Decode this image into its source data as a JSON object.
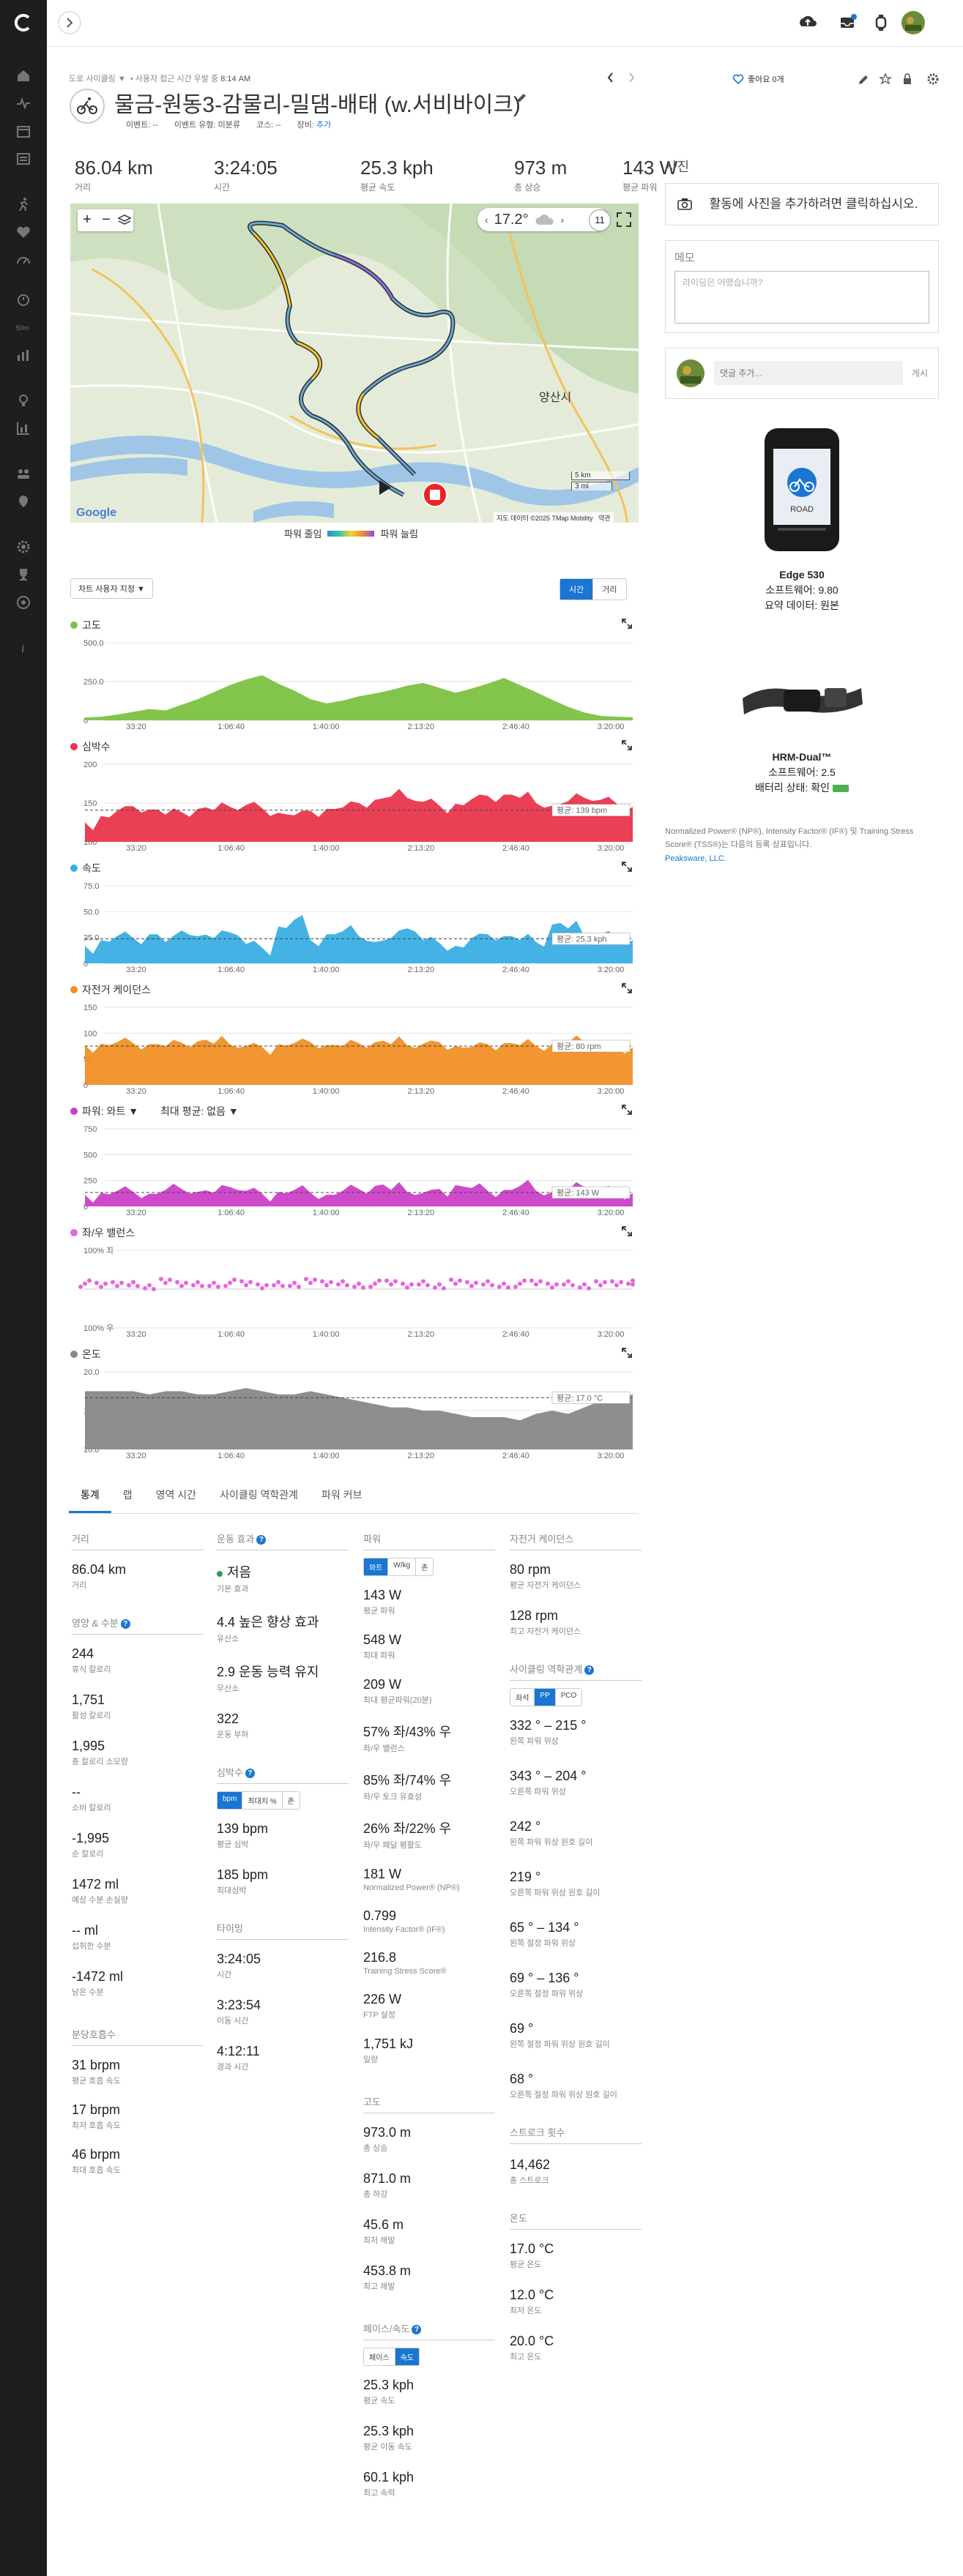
{
  "activity": {
    "breadcrumb": "도로 사이클링",
    "subtitle_privacy": "사용자 접근 시간 우발 중",
    "subtitle_time": "8:14 AM",
    "title": "물금-원동3-감물리-밀댐-배태 (w.서비바이크)",
    "event_label": "이벤트: --",
    "event_type_label": "이벤트 유형: 미분류",
    "course_label": "코스: --",
    "gear_label": "장비:",
    "gear_add": "추가",
    "likes": "좋아요 0개"
  },
  "stats": [
    {
      "value": "86.04 km",
      "label": "거리"
    },
    {
      "value": "3:24:05",
      "label": "시간"
    },
    {
      "value": "25.3 kph",
      "label": "평균 속도"
    },
    {
      "value": "973 m",
      "label": "총 상승"
    },
    {
      "value": "143 W",
      "label": "평균 파워"
    }
  ],
  "map": {
    "temperature": "17.2°",
    "weather_icon": "cloud-icon",
    "scale_km": "5 km",
    "scale_mi": "3 mi",
    "attribution": "지도 데이터 ©2025 TMap Mobility",
    "terms": "약관",
    "google": "Google",
    "city": "양산시",
    "legend_low": "파워 줄임",
    "legend_high": "파워 늘림",
    "counter": "11"
  },
  "chart_controls": {
    "custom": "차트 사용자 지정 ▼",
    "time": "시간",
    "distance": "거리"
  },
  "chart_data": [
    {
      "type": "area",
      "title": "고도",
      "color": "#7cc242",
      "ylabels": [
        "500.0",
        "250.0",
        "0"
      ],
      "ylim": [
        0,
        550
      ],
      "x": [
        "33:20",
        "1:06:40",
        "1:40:00",
        "2:13:20",
        "2:46:40",
        "3:20:00"
      ],
      "values": [
        20,
        25,
        40,
        60,
        80,
        70,
        110,
        150,
        200,
        250,
        290,
        320,
        260,
        210,
        150,
        120,
        140,
        170,
        190,
        215,
        245,
        265,
        230,
        195,
        225,
        260,
        300,
        250,
        200,
        145,
        95,
        55,
        32,
        25,
        22
      ]
    },
    {
      "type": "area",
      "title": "심박수",
      "color": "#e9364d",
      "ylabels": [
        "200",
        "150",
        "100"
      ],
      "ylim": [
        90,
        210
      ],
      "avg": 139,
      "avg_label": "평균: 139 bpm",
      "x": [
        "33:20",
        "1:06:40",
        "1:40:00",
        "2:13:20",
        "2:46:40",
        "3:20:00"
      ],
      "values": [
        120,
        130,
        138,
        145,
        140,
        132,
        136,
        141,
        139,
        144,
        147,
        142,
        135,
        131,
        138,
        141,
        143,
        150,
        155,
        160,
        158,
        152,
        146,
        149,
        156,
        161,
        163,
        158,
        150,
        146,
        153,
        158,
        155,
        149,
        144
      ]
    },
    {
      "type": "area",
      "title": "속도",
      "color": "#3aaee3",
      "ylabels": [
        "75.0",
        "50.0",
        "25.0",
        "0"
      ],
      "ylim": [
        0,
        80
      ],
      "avg": 25.3,
      "avg_label": "평균: 25.3 kph",
      "x": [
        "33:20",
        "1:06:40",
        "1:40:00",
        "2:13:20",
        "2:46:40",
        "3:20:00"
      ],
      "values": [
        18,
        24,
        28,
        26,
        30,
        22,
        34,
        28,
        26,
        32,
        20,
        16,
        38,
        45,
        24,
        30,
        33,
        28,
        22,
        26,
        36,
        24,
        21,
        18,
        26,
        30,
        28,
        24,
        22,
        40,
        36,
        28,
        30,
        27,
        24
      ]
    },
    {
      "type": "area",
      "title": "자전거 케이던스",
      "color": "#f09026",
      "ylabels": [
        "150",
        "100",
        "50",
        "0"
      ],
      "ylim": [
        0,
        160
      ],
      "avg": 80,
      "avg_label": "평균: 80 rpm",
      "x": [
        "33:20",
        "1:06:40",
        "1:40:00",
        "2:13:20",
        "2:46:40",
        "3:20:00"
      ],
      "values": [
        82,
        85,
        88,
        86,
        84,
        80,
        87,
        90,
        85,
        83,
        80,
        78,
        84,
        86,
        88,
        82,
        80,
        86,
        88,
        84,
        82,
        85,
        88,
        80,
        78,
        84,
        86,
        82,
        80,
        84,
        86,
        88,
        82,
        80,
        78
      ]
    },
    {
      "type": "area",
      "title": "파워: 와트 ▼",
      "extra": "최대 평균: 없음 ▼",
      "color": "#cc40c8",
      "ylabels": [
        "750",
        "500",
        "250",
        "0"
      ],
      "ylim": [
        0,
        800
      ],
      "avg": 143,
      "avg_label": "평균: 143 W",
      "x": [
        "33:20",
        "1:06:40",
        "1:40:00",
        "2:13:20",
        "2:46:40",
        "3:20:00"
      ],
      "values": [
        120,
        140,
        160,
        150,
        130,
        170,
        180,
        150,
        140,
        200,
        160,
        130,
        150,
        170,
        140,
        120,
        160,
        180,
        210,
        170,
        150,
        140,
        180,
        220,
        190,
        160,
        170,
        210,
        160,
        150,
        170,
        200,
        180,
        150,
        140
      ]
    },
    {
      "type": "scatter",
      "title": "좌/우 밸런스",
      "color": "#e567dc",
      "ylabels": [
        "100% 좌",
        "100% 우"
      ],
      "x": [
        "33:20",
        "1:06:40",
        "1:40:00",
        "2:13:20",
        "2:46:40",
        "3:20:00"
      ],
      "values": [
        57,
        55,
        58,
        56,
        54,
        59,
        57,
        55,
        56,
        58,
        57,
        55,
        56,
        57,
        59,
        58,
        56,
        55,
        57,
        58,
        56,
        57,
        55,
        58,
        57,
        56,
        55,
        57,
        58,
        56,
        57,
        55,
        56,
        58,
        57
      ]
    },
    {
      "type": "area",
      "title": "온도",
      "color": "#888888",
      "ylabels": [
        "20.0",
        "15.0",
        "10.0"
      ],
      "ylim": [
        9,
        21
      ],
      "avg": 17.0,
      "avg_label": "평균: 17.0 °C",
      "x": [
        "33:20",
        "1:06:40",
        "1:40:00",
        "2:13:20",
        "2:46:40",
        "3:20:00"
      ],
      "values": [
        18,
        18,
        18,
        18,
        17.5,
        18,
        18,
        17.5,
        17.5,
        18,
        18.5,
        18,
        17.5,
        17.5,
        18,
        17.5,
        17,
        16.5,
        16,
        15.5,
        15.5,
        15,
        15,
        14.5,
        14,
        14,
        14,
        13.5,
        14.5,
        15,
        14.5,
        15.5,
        16.5,
        17,
        17.5
      ]
    }
  ],
  "tabs": [
    "통계",
    "랩",
    "영역 시간",
    "사이클링 역학관계",
    "파워 커브"
  ],
  "col1": {
    "distance_h": "거리",
    "distance_v": "86.04 km",
    "distance_l": "거리",
    "nutrition_h": "영양 & 수분",
    "nutrition": [
      {
        "v": "244",
        "l": "휴식 칼로리"
      },
      {
        "v": "1,751",
        "l": "활성 칼로리"
      },
      {
        "v": "1,995",
        "l": "총 칼로리 소모량"
      },
      {
        "v": "--",
        "l": "소비 칼로리"
      },
      {
        "v": "-1,995",
        "l": "순 칼로리"
      },
      {
        "v": "1472 ml",
        "l": "예상 수분 손실량"
      },
      {
        "v": "-- ml",
        "l": "섭취한 수분"
      },
      {
        "v": "-1472 ml",
        "l": "남은 수분"
      }
    ],
    "resp_h": "분당호흡수",
    "resp": [
      {
        "v": "31 brpm",
        "l": "평균 호흡 속도"
      },
      {
        "v": "17 brpm",
        "l": "최저 호흡 속도"
      },
      {
        "v": "46 brpm",
        "l": "최대 호흡 속도"
      }
    ]
  },
  "col2": {
    "effect_h": "운동 효과",
    "effects": [
      {
        "v": "저음",
        "l": "기본 효과"
      },
      {
        "v": "4.4 높은 향상 효과",
        "l": "유산소"
      },
      {
        "v": "2.9 운동 능력 유지",
        "l": "무산소"
      },
      {
        "v": "322",
        "l": "운동 부하"
      }
    ],
    "hr_h": "심박수",
    "hr_toggle": [
      "bpm",
      "최대치 %",
      "존"
    ],
    "hr": [
      {
        "v": "139 bpm",
        "l": "평균 심박"
      },
      {
        "v": "185 bpm",
        "l": "최대심박"
      }
    ],
    "timing_h": "타이밍",
    "timing": [
      {
        "v": "3:24:05",
        "l": "시간"
      },
      {
        "v": "3:23:54",
        "l": "이동 시간"
      },
      {
        "v": "4:12:11",
        "l": "경과 시간"
      }
    ]
  },
  "col3": {
    "power_h": "파워",
    "power_toggle": [
      "와트",
      "W/kg",
      "존"
    ],
    "power": [
      {
        "v": "143 W",
        "l": "평균 파워"
      },
      {
        "v": "548 W",
        "l": "최대 파워"
      },
      {
        "v": "209 W",
        "l": "최대 평균파워(20분)"
      },
      {
        "v": "57% 좌/43% 우",
        "l": "좌/우 밸런스"
      },
      {
        "v": "85% 좌/74% 우",
        "l": "좌/우 토크 유효성"
      },
      {
        "v": "26% 좌/22% 우",
        "l": "좌/우 페달 평활도"
      },
      {
        "v": "181 W",
        "l": "Normalized Power® (NP®)"
      },
      {
        "v": "0.799",
        "l": "Intensity Factor® (IF®)"
      },
      {
        "v": "216.8",
        "l": "Training Stress Score®"
      },
      {
        "v": "226 W",
        "l": "FTP 설정"
      },
      {
        "v": "1,751 kJ",
        "l": "일량"
      }
    ],
    "elev_h": "고도",
    "elev": [
      {
        "v": "973.0 m",
        "l": "총 상승"
      },
      {
        "v": "871.0 m",
        "l": "총 하강"
      },
      {
        "v": "45.6 m",
        "l": "최저 해발"
      },
      {
        "v": "453.8 m",
        "l": "최고 해발"
      }
    ],
    "pace_h": "페이스/속도",
    "pace_toggle": [
      "페이스",
      "속도"
    ],
    "pace": [
      {
        "v": "25.3 kph",
        "l": "평균 속도"
      },
      {
        "v": "25.3 kph",
        "l": "평균 이동 속도"
      },
      {
        "v": "60.1 kph",
        "l": "최고 속력"
      }
    ]
  },
  "col4": {
    "cad_h": "자전거 케이던스",
    "cad": [
      {
        "v": "80 rpm",
        "l": "평균 자전거 케이던스"
      },
      {
        "v": "128 rpm",
        "l": "최고 자전거 케이던스"
      }
    ],
    "dyn_h": "사이클링 역학관계",
    "dyn_toggle": [
      "좌석",
      "PP",
      "PCO"
    ],
    "dyn": [
      {
        "v": "332 ° – 215 °",
        "l": "왼쪽 파워 위상"
      },
      {
        "v": "343 ° – 204 °",
        "l": "오른쪽 파워 위상"
      },
      {
        "v": "242 °",
        "l": "왼쪽 파워 위상 원호 길이"
      },
      {
        "v": "219 °",
        "l": "오른쪽 파워 위상 원호 길이"
      },
      {
        "v": "65 ° – 134 °",
        "l": "왼쪽 절정 파워 위상"
      },
      {
        "v": "69 ° – 136 °",
        "l": "오른쪽 절정 파워 위상"
      },
      {
        "v": "69 °",
        "l": "왼쪽 절정 파워 위상 원호 길이"
      },
      {
        "v": "68 °",
        "l": "오른쪽 절정 파워 위상 원호 길이"
      }
    ],
    "stroke_h": "스트로크 횟수",
    "stroke_v": "14,462",
    "stroke_l": "총 스트로크",
    "temp_h": "온도",
    "temp": [
      {
        "v": "17.0 °C",
        "l": "평균 온도"
      },
      {
        "v": "12.0 °C",
        "l": "최저 온도"
      },
      {
        "v": "20.0 °C",
        "l": "최고 온도"
      }
    ]
  },
  "right": {
    "photos_h": "사진",
    "photos_text": "활동에 사진을 추가하려면 클릭하십시오.",
    "memo_h": "메모",
    "memo_placeholder": "라이딩은 어땠습니까?",
    "comment_placeholder": "댓글 추가...",
    "comment_post": "게시",
    "device1_name": "Edge 530",
    "device1_sw": "소프트웨어: 9.80",
    "device1_data": "요약 데이터: 원본",
    "device1_screen": "ROAD",
    "device2_name": "HRM-Dual™",
    "device2_sw": "소프트웨어: 2.5",
    "device2_battery": "배터리 상태: 확인",
    "footnote": "Normalized Power® (NP®), Intensity Factor® (IF®) 및 Training Stress Score® (TSS®)는 다음의 등록 상표입니다.",
    "footnote_link": "Peaksware, LLC."
  },
  "colors": {
    "accent": "#1976d2",
    "sidebar": "#1e1e1e"
  }
}
